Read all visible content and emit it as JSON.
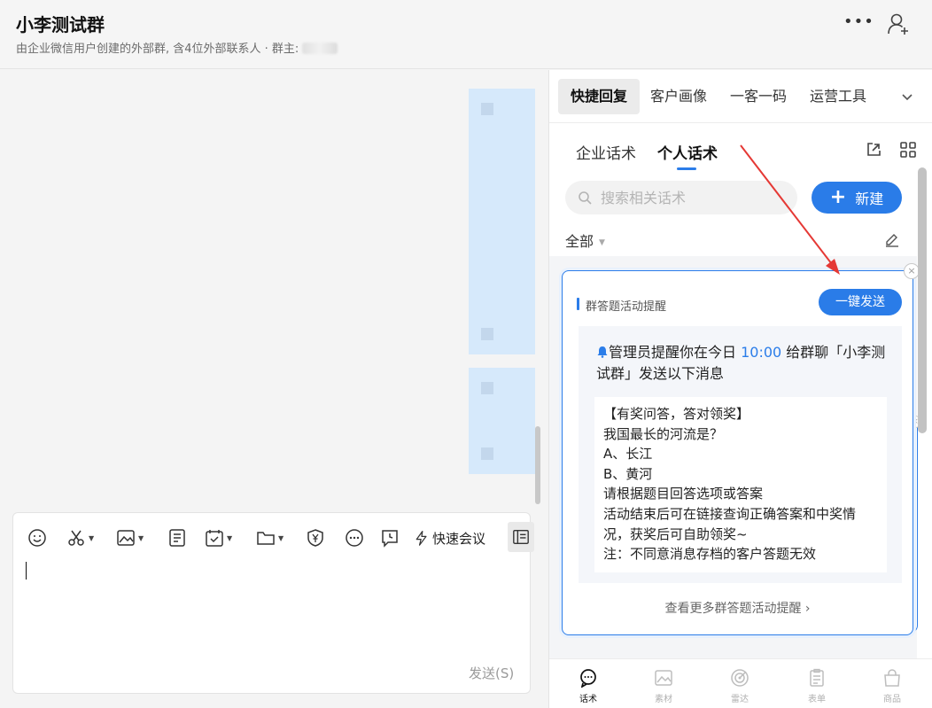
{
  "header": {
    "title": "小李测试群",
    "subtitle": "由企业微信用户创建的外部群, 含4位外部联系人 · 群主: ",
    "more_label": "•••"
  },
  "composer": {
    "meeting_label": "快速会议",
    "send_label": "发送(S)"
  },
  "panel": {
    "top_tabs": [
      "快捷回复",
      "客户画像",
      "一客一码",
      "运营工具"
    ],
    "sub_tabs": [
      "企业话术",
      "个人话术"
    ],
    "search_placeholder": "搜索相关话术",
    "new_label": "新建",
    "filter_label": "全部",
    "card": {
      "category": "群答题活动提醒",
      "send_label": "一键发送",
      "notice_prefix": "管理员提醒你在今日 ",
      "notice_time": "10:00",
      "notice_suffix": " 给群聊「小李测试群」发送以下消息",
      "message_lines": [
        "【有奖问答，答对领奖】",
        "我国最长的河流是？",
        "A、长江",
        "B、黄河",
        "请根据题目回答选项或答案",
        "活动结束后可在链接查询正确答案和中奖情",
        "况，获奖后可自助领奖~",
        "注：不同意消息存档的客户答题无效"
      ],
      "more_link": "查看更多群答题活动提醒 ›"
    },
    "bottom_nav": [
      "话术",
      "素材",
      "雷达",
      "表单",
      "商品"
    ]
  },
  "colors": {
    "accent": "#2a7ce8",
    "annotation_arrow": "#e53935"
  }
}
